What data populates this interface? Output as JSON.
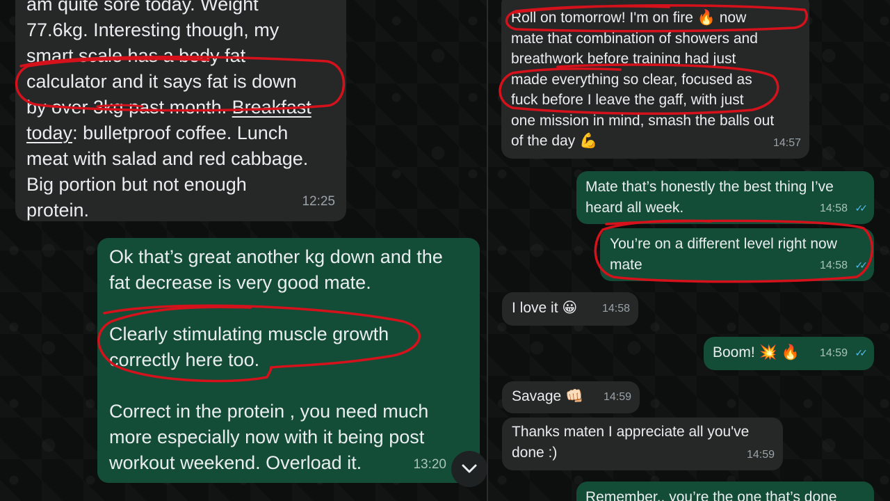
{
  "left": {
    "msg1": {
      "line0": "am quite sore today. Weight",
      "line1": "77.6kg. Interesting though, my",
      "line2": "smart scale has a body fat",
      "line3": "calculator and it says fat is down",
      "line4a": "by over 3kg past month. ",
      "line4b": "Breakfast",
      "line5a": "today",
      "line5b": ": bulletproof coffee. Lunch",
      "line6": "meat with salad and red cabbage.",
      "line7": "Big portion but not enough",
      "line8": "protein.",
      "time": "12:25"
    },
    "msg2": {
      "p1": "Ok that’s great another kg down and the\nfat decrease is very good mate.",
      "p2": "Clearly stimulating muscle growth\ncorrectly here too.",
      "p3": "Correct in the protein , you need much\nmore especially now with it being post\nworkout weekend. Overload it.",
      "time": "13:20"
    }
  },
  "right": {
    "m1": {
      "text": "Roll on tomorrow! I'm on fire 🔥 now\nmate that combination of showers and\nbreathwork before training had just\nmade everything so clear, focused as\nfuck before I leave the gaff, with just\none mission in mind, smash the balls out\nof the day 💪",
      "time": "14:57"
    },
    "m2": {
      "text": "Mate that’s honestly the best thing I’ve\nheard all week.",
      "time": "14:58"
    },
    "m3": {
      "text": "You’re on a different level right now\nmate",
      "time": "14:58"
    },
    "m4": {
      "text": "I love it 😀",
      "time": "14:58"
    },
    "m5": {
      "text": "Boom! 💥 🔥",
      "time": "14:59"
    },
    "m6": {
      "text": "Savage 👊🏻",
      "time": "14:59"
    },
    "m7": {
      "text": "Thanks maten I appreciate all you've\ndone  :)",
      "time": "14:59"
    },
    "m8": {
      "text": "Remember.. you’re the one that’s done"
    }
  },
  "colors": {
    "incoming_bubble": "#262828",
    "outgoing_bubble": "#144d37",
    "read_ticks": "#53bdeb",
    "annotation_ink": "#d5121b"
  },
  "icons": {
    "scroll_down": "chevron-down-icon",
    "read_receipt": "double-check-icon"
  }
}
